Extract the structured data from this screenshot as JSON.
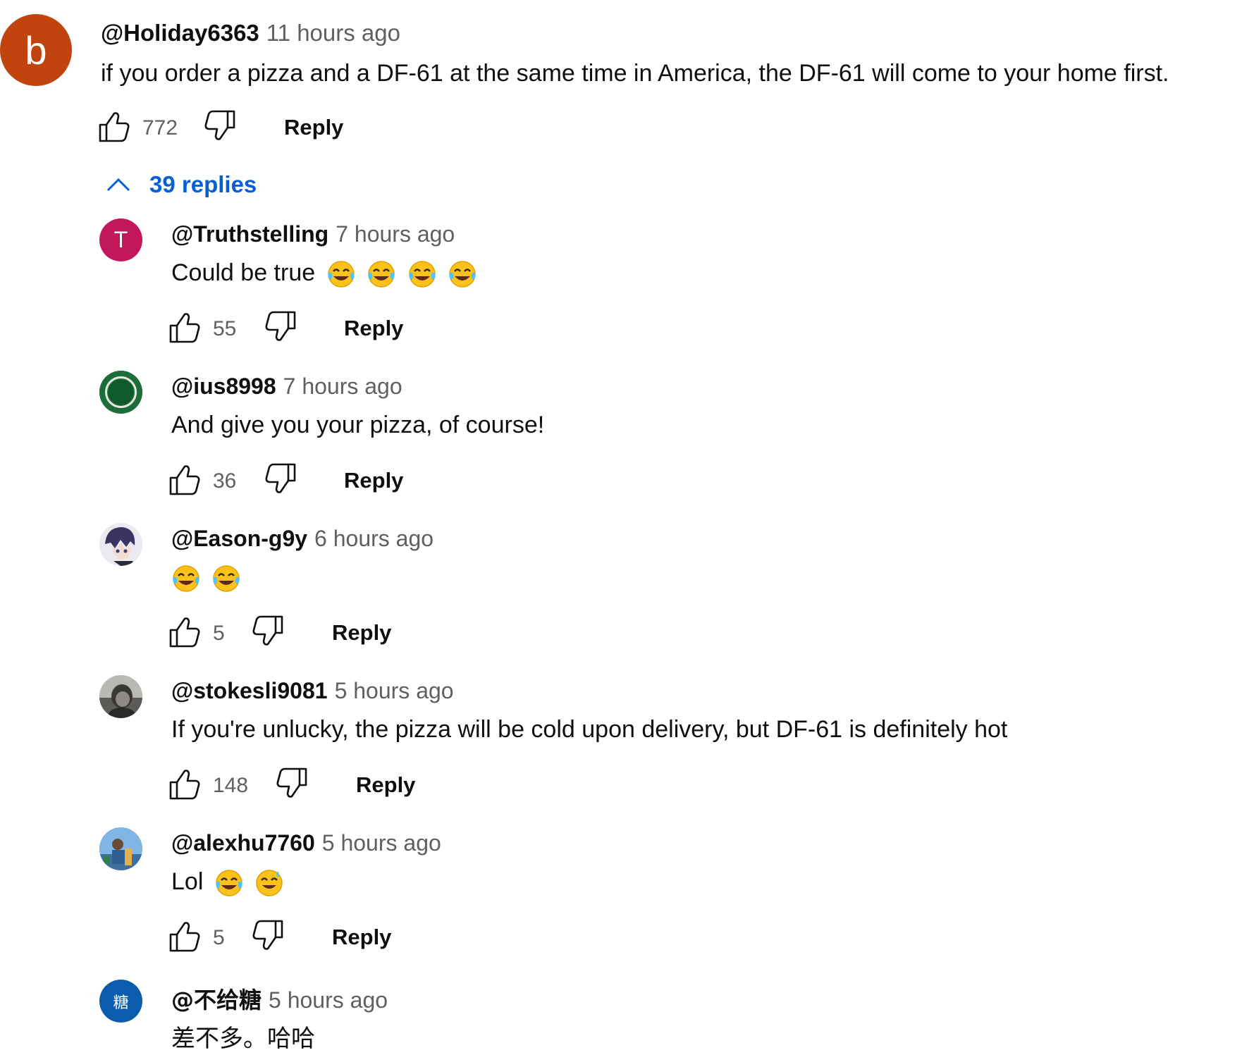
{
  "colors": {
    "link_blue": "#065fd4",
    "secondary_text": "#606060",
    "primary_text": "#0f0f0f"
  },
  "top_comment": {
    "avatar_letter": "b",
    "avatar_color": "#c1440e",
    "author": "@Holiday6363",
    "time": "11 hours ago",
    "text": "if you order a pizza and a DF-61 at the same time in America, the DF-61 will come to your home first.",
    "likes": "772",
    "reply_label": "Reply"
  },
  "replies_toggle": {
    "label": "39 replies",
    "icon": "chevron-up-icon"
  },
  "replies": [
    {
      "avatar": "letter",
      "avatar_letter": "T",
      "avatar_color": "#c2185b",
      "author": "@Truthstelling",
      "time": "7 hours ago",
      "text": "Could be true",
      "emojis": 4,
      "likes": "55",
      "reply_label": "Reply"
    },
    {
      "avatar": "ring-image",
      "author": "@ius8998",
      "time": "7 hours ago",
      "text": "And give you your pizza, of course!",
      "emojis": 0,
      "likes": "36",
      "reply_label": "Reply"
    },
    {
      "avatar": "anime-image",
      "author": "@Eason-g9y",
      "time": "6 hours ago",
      "text": "",
      "emojis": 2,
      "likes": "5",
      "reply_label": "Reply"
    },
    {
      "avatar": "photo-image",
      "author": "@stokesli9081",
      "time": "5 hours ago",
      "text": "If you're unlucky, the pizza will be cold upon delivery, but DF-61 is definitely hot",
      "emojis": 0,
      "likes": "148",
      "reply_label": "Reply"
    },
    {
      "avatar": "outdoor-image",
      "author": "@alexhu7760",
      "time": "5 hours ago",
      "text": "Lol",
      "emojis": 2,
      "likes": "5",
      "reply_label": "Reply"
    },
    {
      "avatar": "letter",
      "avatar_letter": "糖",
      "avatar_color": "#0b5cad",
      "author": "@不给糖",
      "time": "5 hours ago",
      "text": "差不多。哈哈",
      "emojis": 0
    }
  ]
}
